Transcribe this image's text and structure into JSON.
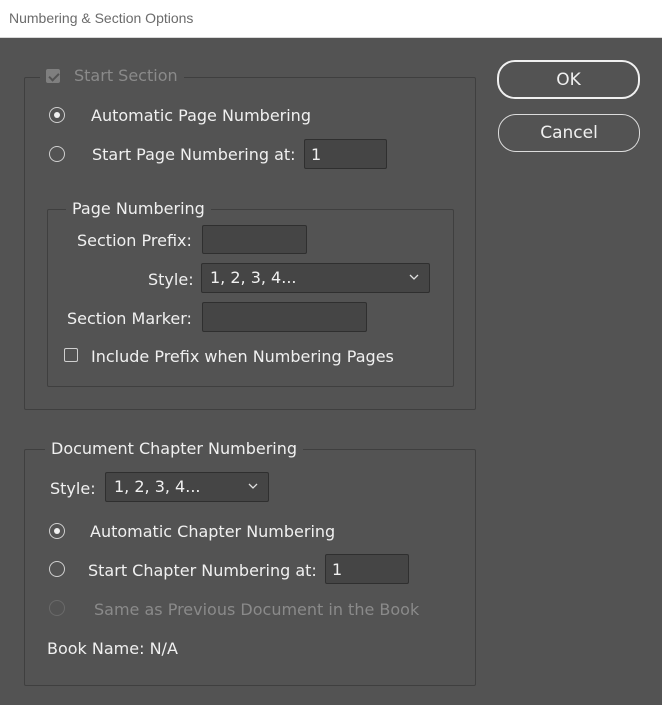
{
  "window": {
    "title": "Numbering & Section Options"
  },
  "buttons": {
    "ok": "OK",
    "cancel": "Cancel"
  },
  "start_section": {
    "label": "Start Section",
    "checked": true,
    "enabled": false
  },
  "page_numbering_mode": {
    "automatic": "Automatic Page Numbering",
    "start_at": "Start Page Numbering at:",
    "start_at_value": "1",
    "selected": "automatic"
  },
  "page_numbering": {
    "title": "Page Numbering",
    "section_prefix_label": "Section Prefix:",
    "section_prefix_value": "",
    "style_label": "Style:",
    "style_value": "1, 2, 3, 4...",
    "section_marker_label": "Section Marker:",
    "section_marker_value": "",
    "include_prefix_label": "Include Prefix when Numbering Pages",
    "include_prefix_checked": false
  },
  "chapter_numbering": {
    "title": "Document Chapter Numbering",
    "style_label": "Style:",
    "style_value": "1, 2, 3, 4...",
    "automatic": "Automatic Chapter Numbering",
    "start_at": "Start Chapter Numbering at:",
    "start_at_value": "1",
    "same_as_previous": "Same as Previous Document in the Book",
    "selected": "automatic",
    "book_name": "Book Name: N/A"
  },
  "colors": {
    "background": "#535353",
    "text": "#f0f0f0",
    "disabled": "#8a8a8a",
    "field": "#454545"
  }
}
